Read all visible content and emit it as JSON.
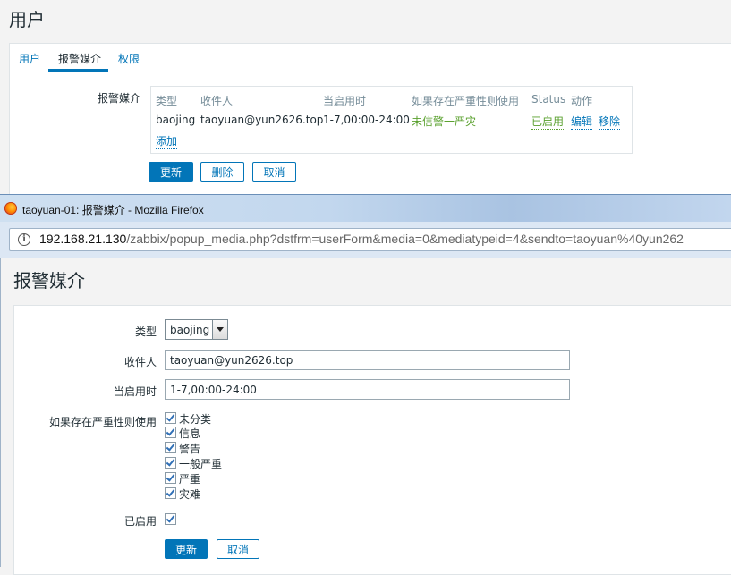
{
  "page": {
    "title": "用户",
    "tabs": [
      {
        "label": "用户"
      },
      {
        "label": "报警媒介"
      },
      {
        "label": "权限"
      }
    ],
    "media_label": "报警媒介",
    "media_table": {
      "headers": [
        "类型",
        "收件人",
        "当启用时",
        "如果存在严重性则使用",
        "Status",
        "动作"
      ],
      "row": {
        "type": "baojing",
        "sendto": "taoyuan@yun2626.top",
        "period": "1-7,00:00-24:00",
        "severity": "未信警一严灾",
        "status": "已启用",
        "edit": "编辑",
        "remove": "移除"
      },
      "add": "添加"
    },
    "buttons": {
      "update": "更新",
      "delete": "删除",
      "cancel": "取消"
    }
  },
  "firefox": {
    "window_title": "taoyuan-01: 报警媒介 - Mozilla Firefox",
    "url_host": "192.168.21.130",
    "url_path": "/zabbix/popup_media.php?dstfrm=userForm&media=0&mediatypeid=4&sendto=taoyuan%40yun262"
  },
  "popup": {
    "title": "报警媒介",
    "type_label": "类型",
    "type_value": "baojing",
    "sendto_label": "收件人",
    "sendto_value": "taoyuan@yun2626.top",
    "period_label": "当启用时",
    "period_value": "1-7,00:00-24:00",
    "severity_label": "如果存在严重性则使用",
    "severities": [
      "未分类",
      "信息",
      "警告",
      "一般严重",
      "严重",
      "灾难"
    ],
    "enabled_label": "已启用",
    "update_button": "更新",
    "cancel_button": "取消"
  },
  "colors": {
    "accent": "#0275b8",
    "enabled_green": "#59a02d"
  }
}
